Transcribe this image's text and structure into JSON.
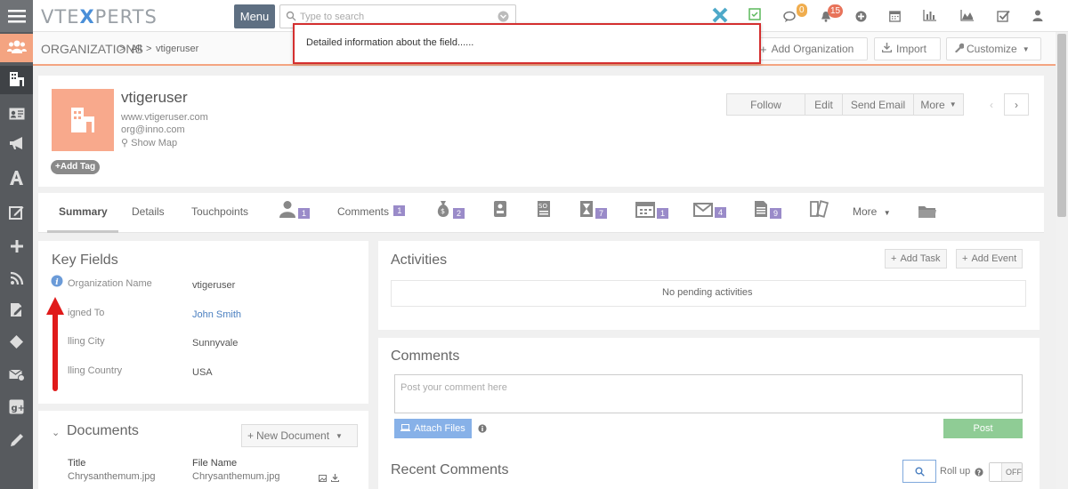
{
  "brand": {
    "logo_text_a": "VTE",
    "logo_text_b": "X",
    "logo_text_c": "PERTS"
  },
  "topbar": {
    "menu_label": "Menu",
    "search_placeholder": "Type to search",
    "notif_chat_count": "0",
    "notif_bell_count": "15"
  },
  "breadcrumb": {
    "module": "ORGANIZATIONS",
    "sep1": ">",
    "all": "All",
    "sep2": ">",
    "record": "vtigeruser"
  },
  "toolbar": {
    "add": "Add Organization",
    "import": "Import",
    "customize": "Customize"
  },
  "tooltip": {
    "text": "Detailed information about the field......"
  },
  "record": {
    "name": "vtigeruser",
    "website": "www.vtigeruser.com",
    "email": "org@inno.com",
    "show_map": "Show Map",
    "add_tag": "Add Tag",
    "actions": [
      "Follow",
      "Edit",
      "Send Email",
      "More"
    ]
  },
  "tabs": {
    "summary": "Summary",
    "details": "Details",
    "touchpoints": "Touchpoints",
    "contacts_count": "1",
    "comments": "Comments",
    "comments_count": "1",
    "deals_count": "2",
    "tickets_count": "7",
    "events_count": "1",
    "emails_count": "4",
    "docs_count": "9",
    "more": "More"
  },
  "key_fields": {
    "title": "Key Fields",
    "rows": [
      {
        "label": "Organization Name",
        "value": "vtigeruser"
      },
      {
        "label": "igned To",
        "value": "John Smith"
      },
      {
        "label": "lling City",
        "value": "Sunnyvale"
      },
      {
        "label": "lling Country",
        "value": "USA"
      }
    ]
  },
  "activities": {
    "title": "Activities",
    "add_task": "Add Task",
    "add_event": "Add Event",
    "empty": "No pending activities"
  },
  "comments": {
    "title": "Comments",
    "placeholder": "Post your comment here",
    "attach": "Attach Files",
    "post": "Post"
  },
  "recent_comments": {
    "title": "Recent Comments",
    "roll_up": "Roll up",
    "toggle": "OFF"
  },
  "documents": {
    "title": "Documents",
    "new_doc": "New Document",
    "col_title": "Title",
    "col_file": "File Name",
    "row_title": "Chrysanthemum.jpg",
    "row_file": "Chrysanthemum.jpg"
  },
  "colors": {
    "accent": "#f4a481",
    "sidebar": "#575a5e",
    "badge_purple": "#9a8bc9",
    "tooltip_border": "#d42f2f"
  }
}
